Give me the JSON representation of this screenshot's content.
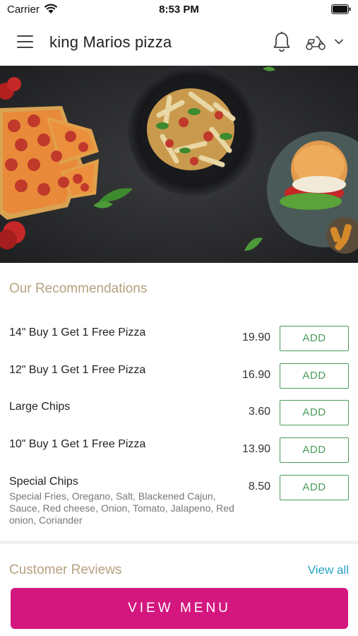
{
  "status_bar": {
    "carrier": "Carrier",
    "time": "8:53 PM"
  },
  "header": {
    "title": "king Marios pizza",
    "icons": [
      "menu-icon",
      "bell-icon",
      "scooter-icon",
      "chevron-down-icon"
    ]
  },
  "recommendations": {
    "title": "Our Recommendations",
    "items": [
      {
        "name": "14\" Buy 1 Get 1 Free Pizza",
        "price": "19.90",
        "add_label": "ADD"
      },
      {
        "name": "12\" Buy 1 Get 1 Free Pizza",
        "price": "16.90",
        "add_label": "ADD"
      },
      {
        "name": "Large Chips",
        "price": "3.60",
        "add_label": "ADD"
      },
      {
        "name": "10\" Buy 1 Get 1 Free Pizza",
        "price": "13.90",
        "add_label": "ADD"
      },
      {
        "name": "Special Chips",
        "description": "Special Fries, Oregano, Salt, Blackened Cajun, Sauce, Red cheese, Onion, Tomato, Jalapeno, Red onion, Coriander",
        "price": "8.50",
        "add_label": "ADD"
      }
    ]
  },
  "reviews": {
    "title": "Customer Reviews",
    "view_all_label": "View all"
  },
  "footer": {
    "view_menu_label": "VIEW MENU"
  },
  "colors": {
    "accent_gold": "#b6a180",
    "add_green": "#4a9c5a",
    "link_blue": "#2aa3c8",
    "primary_magenta": "#d4177f"
  }
}
